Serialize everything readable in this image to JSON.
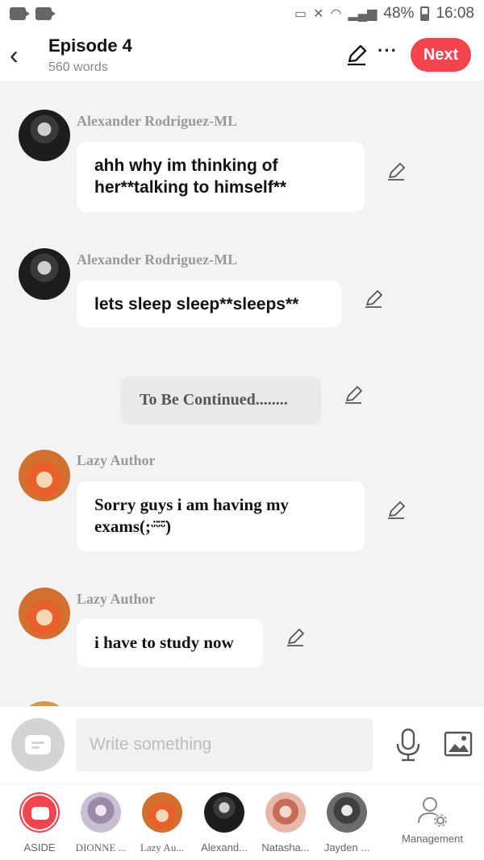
{
  "status_bar": {
    "battery": "48%",
    "time": "16:08",
    "icons": [
      "video-camera-icon",
      "video-camera-icon",
      "cast-icon",
      "mute-icon",
      "wifi-icon",
      "signal-icon",
      "battery-icon"
    ]
  },
  "header": {
    "title": "Episode 4",
    "word_count": "560 words",
    "next_label": "Next",
    "icons": [
      "back-arrow-icon",
      "pencil-icon",
      "more-icon"
    ]
  },
  "messages": [
    {
      "author": "Alexander Rodriguez-ML",
      "text": "ahh why im thinking of her**talking to himself**"
    },
    {
      "author": "Alexander Rodriguez-ML",
      "text": "lets sleep sleep**sleeps**"
    },
    {
      "narration": "To Be Continued........"
    },
    {
      "author": "Lazy Author",
      "text": "Sorry guys i am having my exams(;ᵕ̈ᵕ̈ᵕ̈)"
    },
    {
      "author": "Lazy Author",
      "text": "i have to study now"
    }
  ],
  "input": {
    "placeholder": "Write something",
    "icons": [
      "aside-icon",
      "microphone-icon",
      "image-icon"
    ]
  },
  "characters": [
    {
      "label": "ASIDE"
    },
    {
      "label": "DIONNE ..."
    },
    {
      "label": "Lazy Au..."
    },
    {
      "label": "Alexand..."
    },
    {
      "label": "Natasha..."
    },
    {
      "label": "Jayden ..."
    },
    {
      "label": "Management"
    }
  ],
  "colors": {
    "accent": "#f5444d",
    "background": "#f3f3f3",
    "bubble": "#ffffff",
    "narration_bubble": "#e9e9e9"
  }
}
